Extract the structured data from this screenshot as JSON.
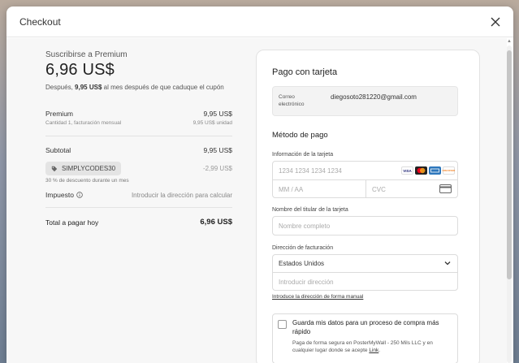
{
  "modal": {
    "title": "Checkout"
  },
  "summary": {
    "subscribe_label": "Suscribirse a Premium",
    "price": "6,96 US$",
    "after_prefix": "Después, ",
    "after_bold": "9,95 US$",
    "after_suffix": " al mes después de que caduque el cupón",
    "item_name": "Premium",
    "item_price": "9,95 US$",
    "item_detail": "Cantidad 1, facturación mensual",
    "item_unit": "9,95 US$ unidad",
    "subtotal_label": "Subtotal",
    "subtotal_value": "9,95 US$",
    "coupon_code": "SIMPLYCODES30",
    "coupon_discount": "-2,99 US$",
    "coupon_note": "30 % de descuento durante un mes",
    "tax_label": "Impuesto",
    "tax_value": "Introducir la dirección para calcular",
    "total_label": "Total a pagar hoy",
    "total_value": "6,96 US$"
  },
  "payment": {
    "title": "Pago con tarjeta",
    "email_label": "Correo electrónico",
    "email_value": "diegosoto281220@gmail.com",
    "method_title": "Método de pago",
    "card_info_label": "Información de la tarjeta",
    "card_number_placeholder": "1234 1234 1234 1234",
    "expiry_placeholder": "MM / AA",
    "cvc_placeholder": "CVC",
    "cvc_icon_text": "123",
    "brands": [
      "VISA",
      "",
      "",
      "DISCOVER"
    ],
    "holder_label": "Nombre del titular de la tarjeta",
    "holder_placeholder": "Nombre completo",
    "billing_label": "Dirección de facturación",
    "country_value": "Estados Unidos",
    "address_placeholder": "Introducir dirección",
    "manual_link": "Introduce la dirección de forma manual",
    "save_title": "Guarda mis datos para un proceso de compra más rápido",
    "save_desc_prefix": "Paga de forma segura en PosterMyWall - 250 Mils LLC y en cualquier lugar donde se acepte ",
    "save_desc_link": "Link",
    "save_desc_suffix": "."
  },
  "colors": {
    "accent": "#222222",
    "background": "#f7f7f7"
  }
}
